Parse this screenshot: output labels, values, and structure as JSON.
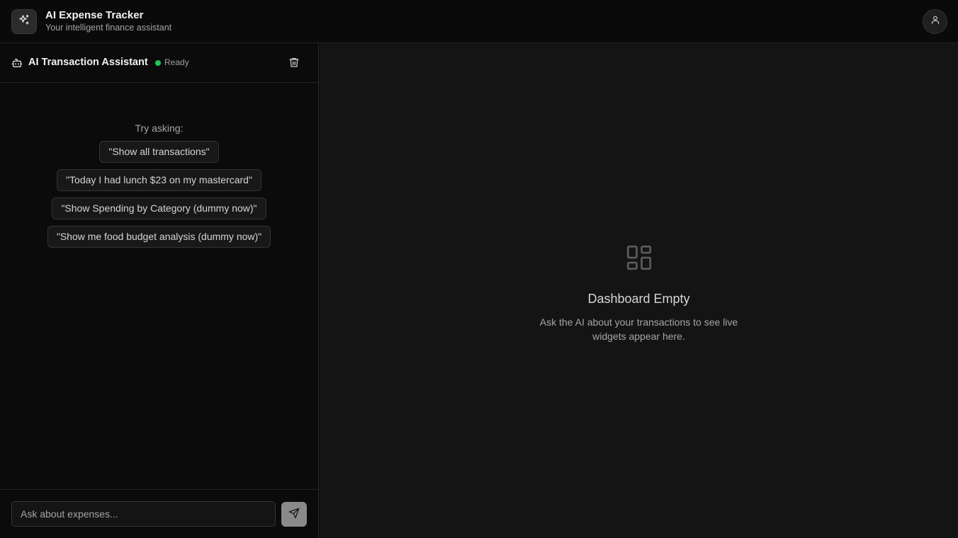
{
  "header": {
    "title": "AI Expense Tracker",
    "subtitle": "Your intelligent finance assistant",
    "logo_icon": "sparkles-icon",
    "profile_icon": "user-icon"
  },
  "assistant": {
    "title": "AI Transaction Assistant",
    "status": "Ready",
    "status_color": "#22c55e",
    "icon": "bot-icon",
    "clear_icon": "trash-icon"
  },
  "suggestions": {
    "label": "Try asking:",
    "items": [
      "\"Show all transactions\"",
      "\"Today I had lunch $23 on my mastercard\"",
      "\"Show Spending by Category (dummy now)\"",
      "\"Show me food budget analysis (dummy now)\""
    ]
  },
  "input": {
    "placeholder": "Ask about expenses...",
    "send_icon": "send-icon"
  },
  "dashboard": {
    "icon": "layout-dashboard-icon",
    "empty_title": "Dashboard Empty",
    "empty_description": "Ask the AI about your transactions to see live widgets appear here."
  }
}
